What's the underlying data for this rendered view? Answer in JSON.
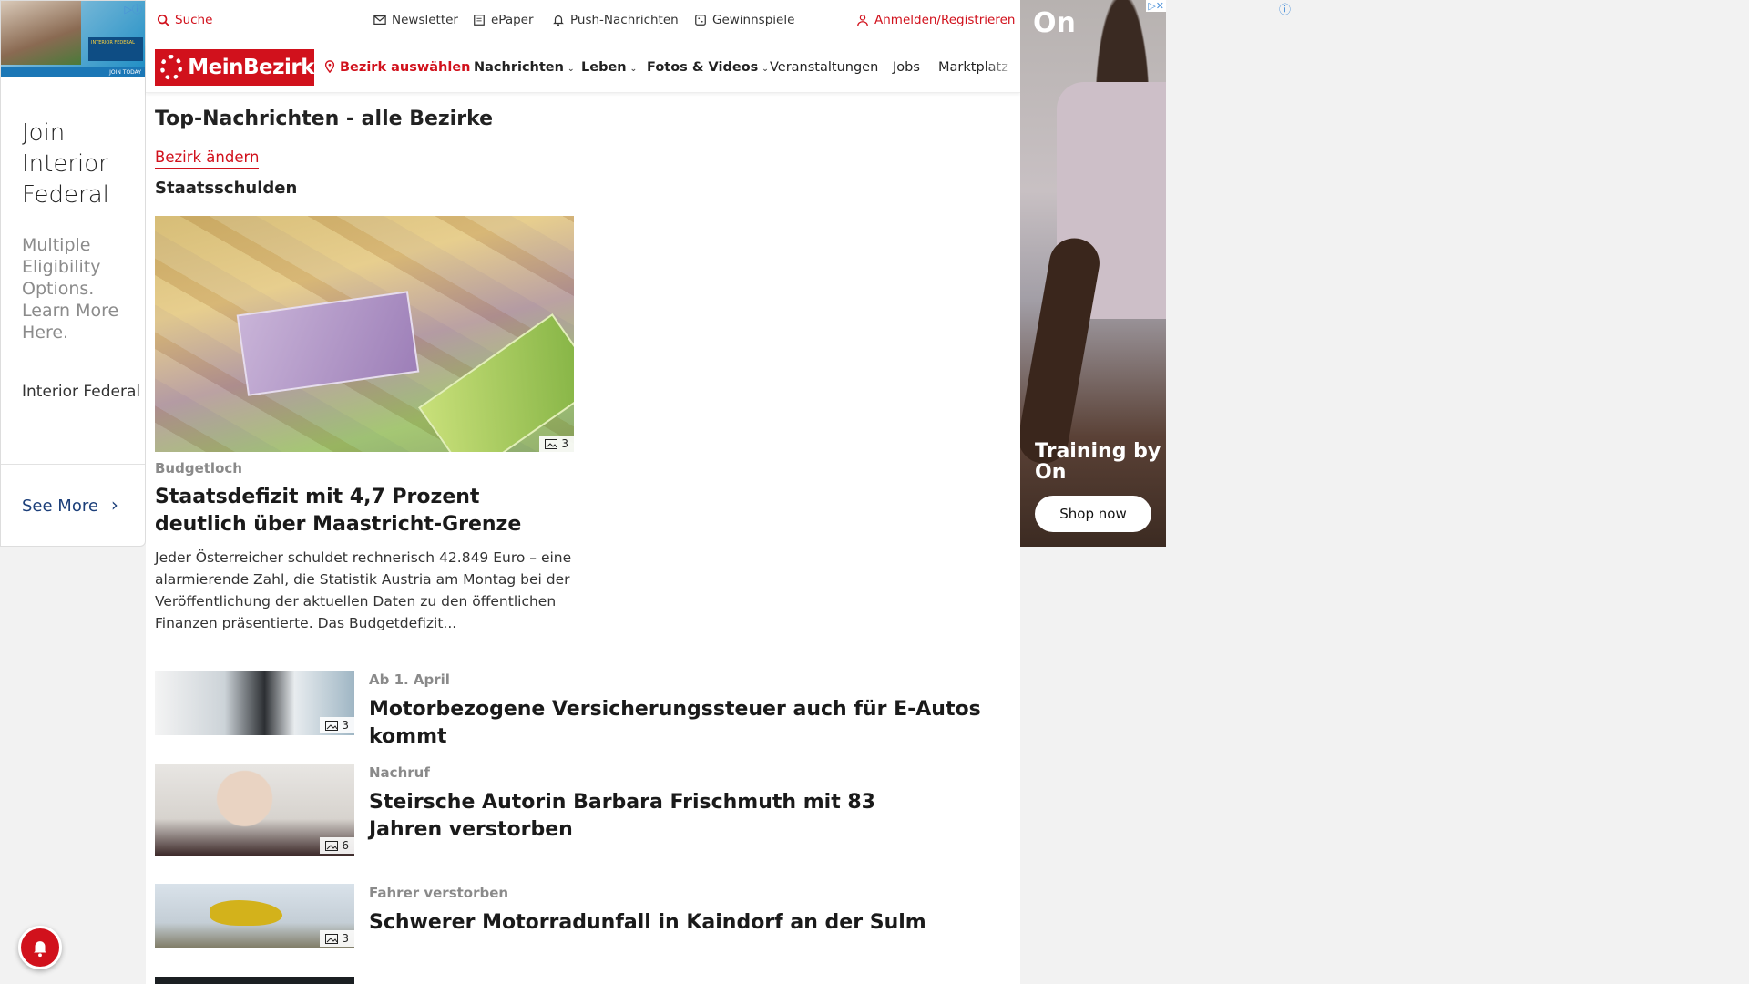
{
  "left_ad": {
    "headline": "Join Interior Federal",
    "body": "Multiple Eligibility Options. Learn More Here.",
    "brand": "Interior Federal",
    "cta": "See More",
    "banner_tag": "INTERIOR FEDERAL",
    "banner_cta": "JOIN TODAY"
  },
  "topbar": {
    "search": "Suche",
    "newsletter": "Newsletter",
    "epaper": "ePaper",
    "push": "Push-Nachrichten",
    "contests": "Gewinnspiele",
    "login": "Anmelden/Registrieren"
  },
  "navbar": {
    "logo": "MeinBezirk",
    "district": "Bezirk auswählen",
    "items": [
      "Nachrichten",
      "Leben",
      "Fotos & Videos",
      "Veranstaltungen",
      "Jobs",
      "Marktplatz"
    ]
  },
  "page": {
    "title": "Top-Nachrichten - alle Bezirke",
    "change_link": "Bezirk ändern",
    "section": "Staatsschulden"
  },
  "hero": {
    "photo_count": "3",
    "kicker": "Budgetloch",
    "headline": "Staatsdefizit mit 4,7 Prozent deutlich über Maastricht-Grenze",
    "teaser": "Jeder Österreicher schuldet rechnerisch 42.849 Euro – eine alarmierende Zahl, die Statistik Austria am Montag bei der Veröffentlichung der aktuellen Daten zu den öffentlichen Finanzen präsentierte. Das Budgetdefizit..."
  },
  "articles": [
    {
      "kicker": "Ab 1. April",
      "headline": "Motorbezogene Versicherungssteuer auch für E-Autos kommt",
      "photo_count": "3"
    },
    {
      "kicker": "Nachruf",
      "headline": "Steirsche Autorin Barbara Frischmuth mit 83 Jahren verstorben",
      "photo_count": "6"
    },
    {
      "kicker": "Fahrer verstorben",
      "headline": "Schwerer Motorradunfall in Kaindorf an der Sulm",
      "photo_count": "3"
    }
  ],
  "right_ad": {
    "logo": "On",
    "claim": "Training by On",
    "cta": "Shop now"
  },
  "colors": {
    "brand_red": "#d1111c",
    "ad_link_blue": "#1c3f7a"
  }
}
